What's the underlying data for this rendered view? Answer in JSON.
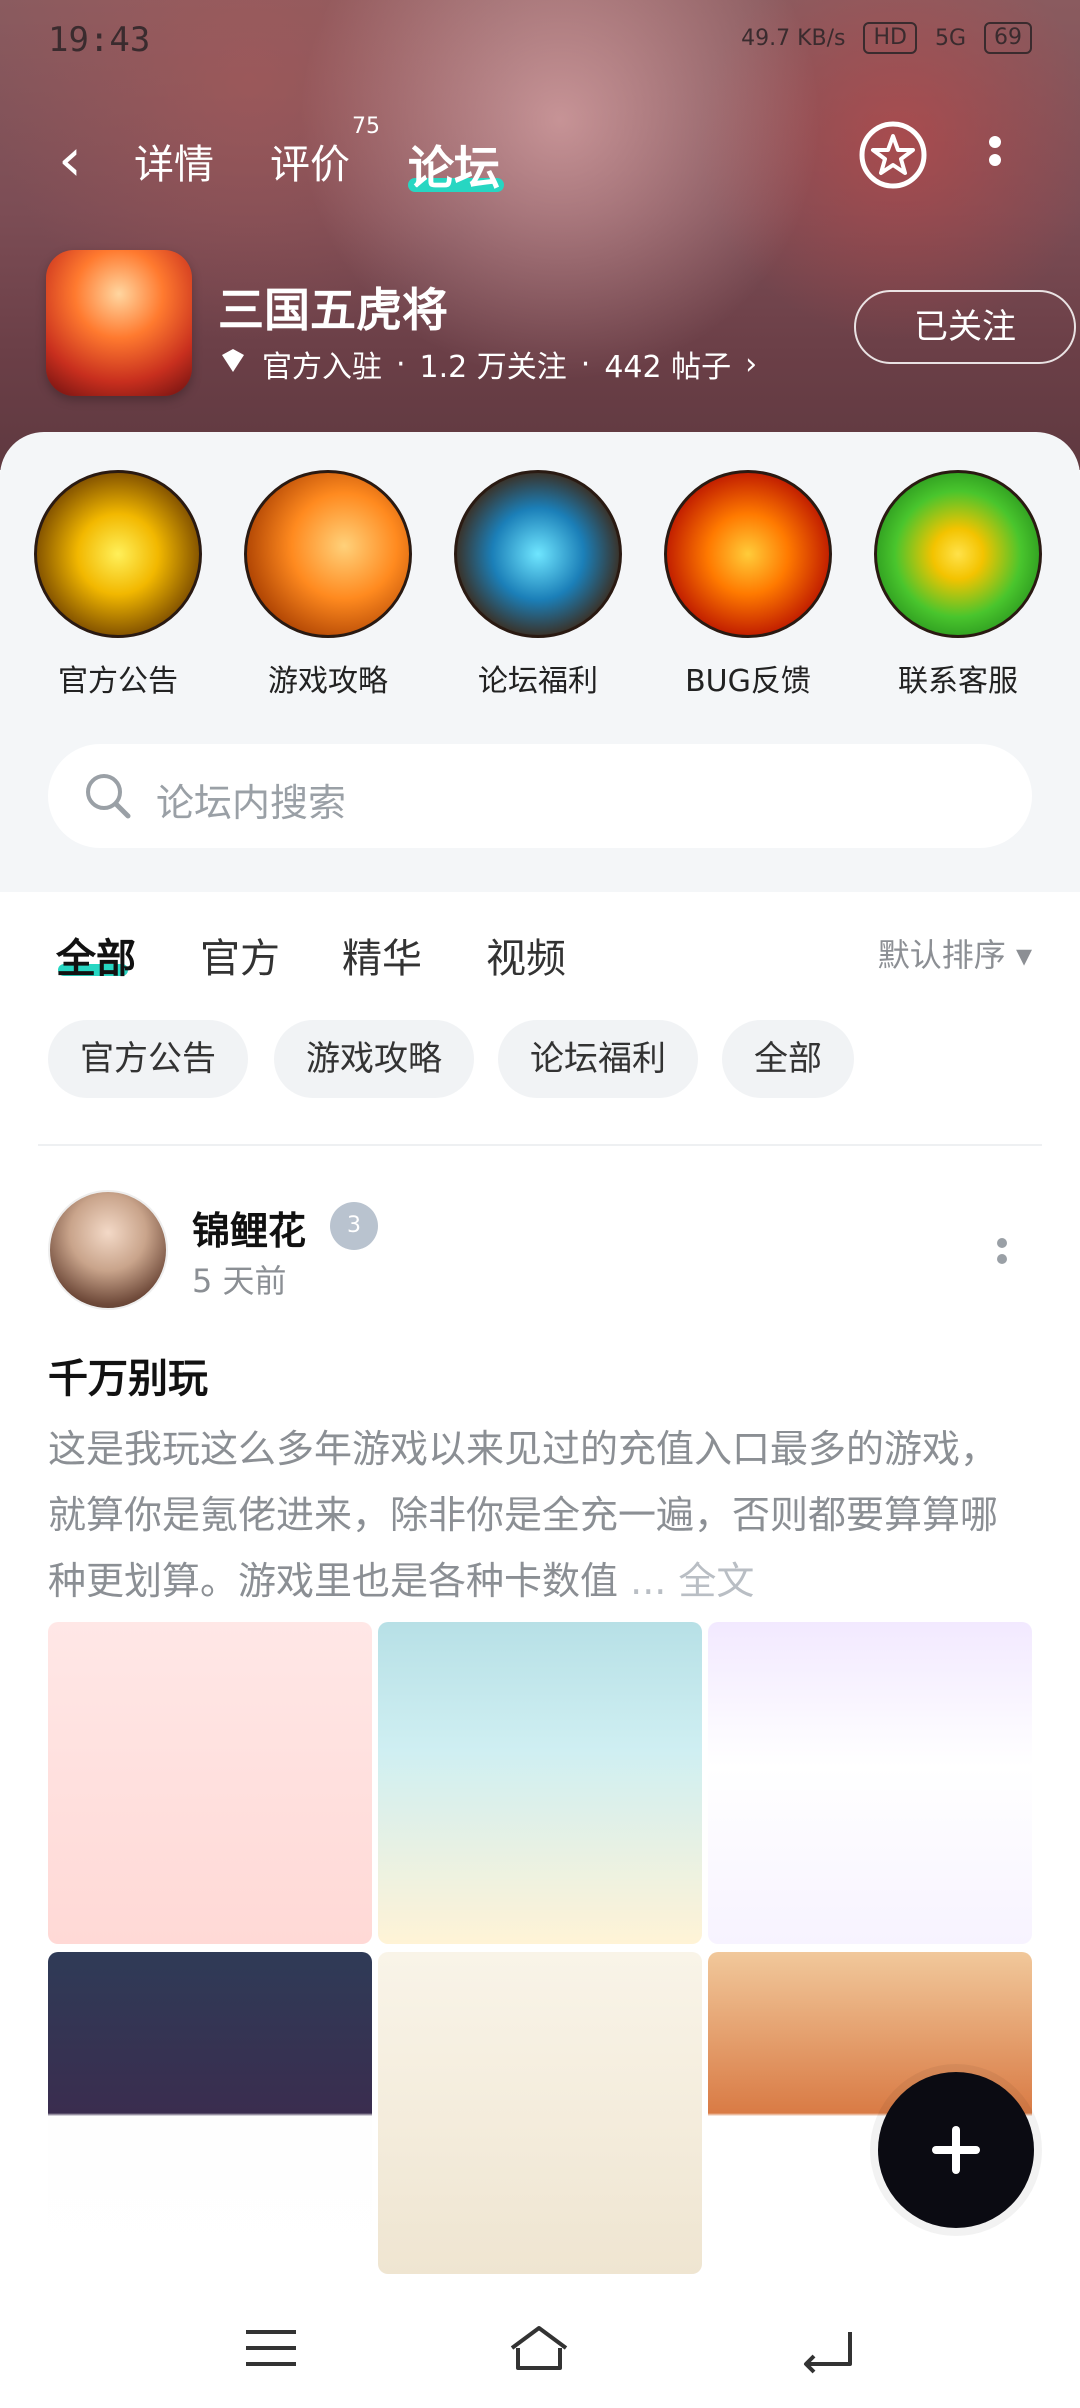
{
  "status": {
    "time": "19:43",
    "network_speed": "49.7 KB/s",
    "hd": "HD",
    "signal": "5G",
    "battery": "69"
  },
  "nav": {
    "tabs": [
      {
        "label": "详情"
      },
      {
        "label": "评价",
        "badge": "75"
      },
      {
        "label": "论坛"
      }
    ]
  },
  "app": {
    "name": "三国五虎将",
    "badge": "官方入驻",
    "followers": "1.2 万关注",
    "posts": "442 帖子",
    "follow_button": "已关注"
  },
  "shortcuts": [
    {
      "label": "官方公告",
      "icon": "eye-icon"
    },
    {
      "label": "游戏攻略",
      "icon": "sword-icon"
    },
    {
      "label": "论坛福利",
      "icon": "gift-icon"
    },
    {
      "label": "BUG反馈",
      "icon": "pumpkin-icon"
    },
    {
      "label": "联系客服",
      "icon": "plus-icon"
    }
  ],
  "search": {
    "placeholder": "论坛内搜索"
  },
  "feed_tabs": [
    "全部",
    "官方",
    "精华",
    "视频"
  ],
  "sort_label": "默认排序",
  "chips": [
    "官方公告",
    "游戏攻略",
    "论坛福利",
    "全部"
  ],
  "post": {
    "author": "锦鲤花",
    "level": "3",
    "time": "5 天前",
    "title": "千万别玩",
    "body": "这是我玩这么多年游戏以来见过的充值入口最多的游戏，就算你是氪佬进来，除非你是全充一遍，否则都要算算哪种更划算。游戏里也是各种卡数值",
    "more": "... 全文"
  },
  "colors": {
    "accent": "#27d6c2",
    "banner": "#7c4d55"
  }
}
